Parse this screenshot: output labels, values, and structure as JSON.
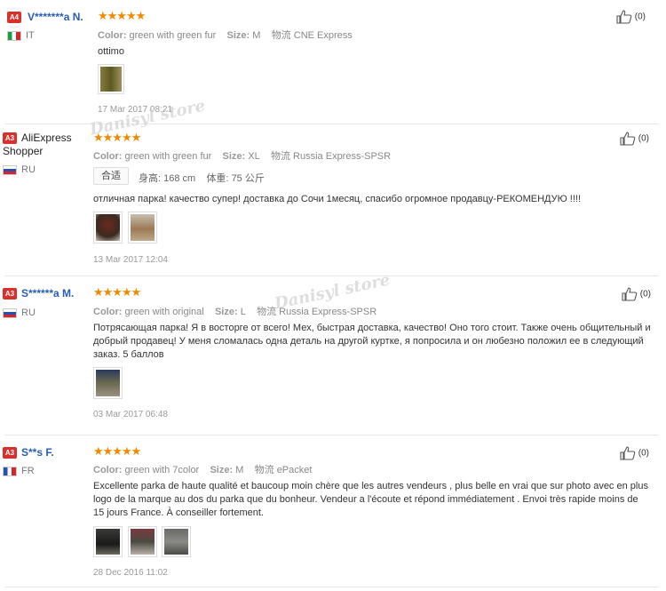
{
  "reviews": [
    {
      "badge": "A4",
      "name": "V*******a N.",
      "country": "IT",
      "stars": "★★★★★",
      "color_label": "Color:",
      "color_value": "green with green fur",
      "size_label": "Size:",
      "size_value": "M",
      "ship_label": "物流",
      "ship_value": "CNE Express",
      "text": "ottimo",
      "date": "17 Mar 2017 08:21",
      "likes": "(0)"
    },
    {
      "badge": "A3",
      "name": "AliExpress Shopper",
      "country": "RU",
      "stars": "★★★★★",
      "color_label": "Color:",
      "color_value": "green with green fur",
      "size_label": "Size:",
      "size_value": "XL",
      "ship_label": "物流",
      "ship_value": "Russia Express-SPSR",
      "fit": "合适",
      "height_label": "身高:",
      "height_value": "168 cm",
      "weight_label": "体重:",
      "weight_value": "75 公斤",
      "text": "отличная парка! качество супер! доставка до Сочи 1месяц, спасибо огромное продавцу-РЕКОМЕНДУЮ !!!!",
      "date": "13 Mar 2017 12:04",
      "likes": "(0)"
    },
    {
      "badge": "A3",
      "name": "S******a M.",
      "country": "RU",
      "stars": "★★★★★",
      "color_label": "Color:",
      "color_value": "green with original",
      "size_label": "Size:",
      "size_value": "L",
      "ship_label": "物流",
      "ship_value": "Russia Express-SPSR",
      "text": "Потрясающая парка! Я в восторге от всего! Мех, быстрая доставка, качество! Оно того стоит. Также очень общительный и добрый продавец! У меня сломалась одна деталь на другой куртке, я попросила и он любезно положил ее в следующий заказ. 5 баллов",
      "date": "03 Mar 2017 06:48",
      "likes": "(0)"
    },
    {
      "badge": "A3",
      "name": "S**s F.",
      "country": "FR",
      "stars": "★★★★★",
      "color_label": "Color:",
      "color_value": "green with 7color",
      "size_label": "Size:",
      "size_value": "M",
      "ship_label": "物流",
      "ship_value": "ePacket",
      "text": "Excellente parka de haute qualité et baucoup moin chère que les autres vendeurs , plus belle en vrai que sur photo avec en plus logo de la marque au dos du parka que du bonheur. Vendeur a l'écoute et répond immédiatement . Envoi très rapide moins de 15 jours France. À conseiller fortement.",
      "date": "28 Dec 2016 11:02",
      "likes": "(0)"
    }
  ],
  "watermark": "Danisyl store",
  "colors": {
    "name": "#2a5db0",
    "star": "#f08a00",
    "badge": "#d9302b"
  }
}
